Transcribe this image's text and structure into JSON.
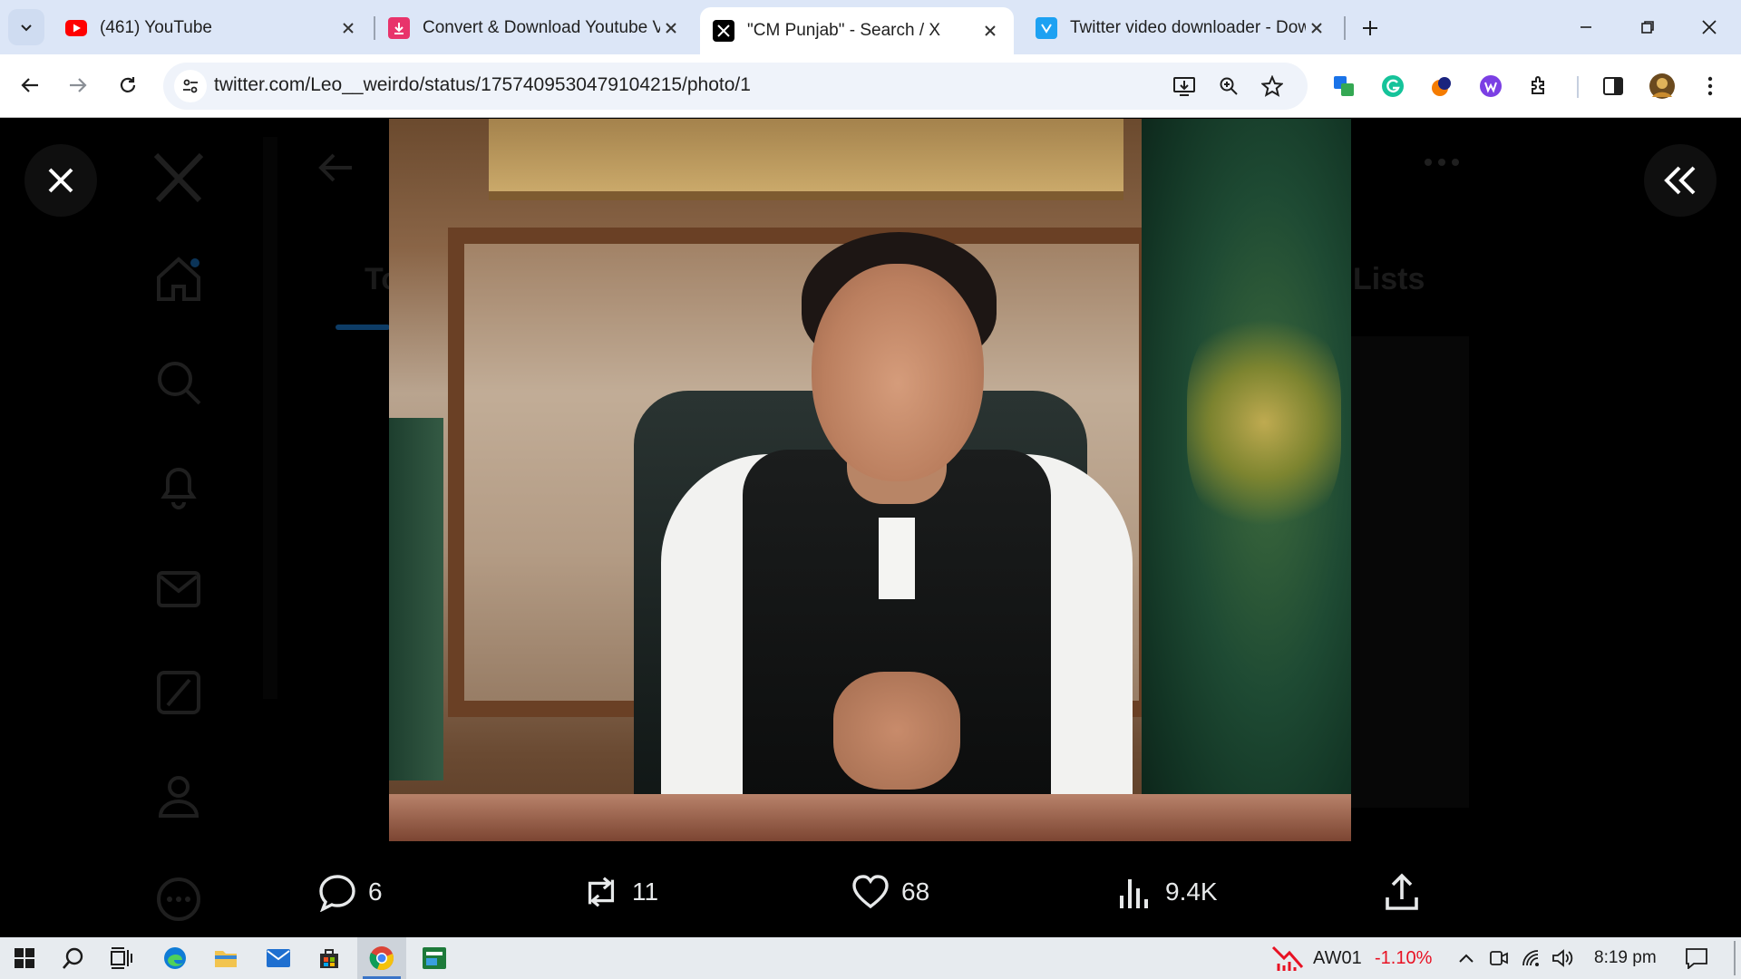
{
  "browser": {
    "tabs": [
      {
        "title": "(461) YouTube",
        "favicon": "youtube-icon",
        "active": false
      },
      {
        "title": "Convert & Download Youtube Vi",
        "favicon": "download-site-icon",
        "active": false
      },
      {
        "title": "\"CM Punjab\" - Search / X",
        "favicon": "x-logo-icon",
        "active": true
      },
      {
        "title": "Twitter video downloader - Dow",
        "favicon": "twitter-downloader-icon",
        "active": false
      }
    ],
    "url": "twitter.com/Leo__weirdo/status/1757409530479104215/photo/1"
  },
  "x_page": {
    "background_tab_left": "To",
    "background_tab_right": "Lists"
  },
  "photo_viewer": {
    "photo_alt": "Portrait photo of a man seated at a desk"
  },
  "actions": {
    "replies": "6",
    "reposts": "11",
    "likes": "68",
    "views": "9.4K"
  },
  "taskbar": {
    "ticker_name": "AW01",
    "ticker_change": "-1.10%",
    "clock": "8:19 pm"
  },
  "colors": {
    "tabstrip": "#dce6f7",
    "toolbar": "#ffffff",
    "viewer_bg": "#000000",
    "action_text": "#e7e9ea",
    "ticker_negative": "#e81123",
    "taskbar": "#e7ebef"
  }
}
